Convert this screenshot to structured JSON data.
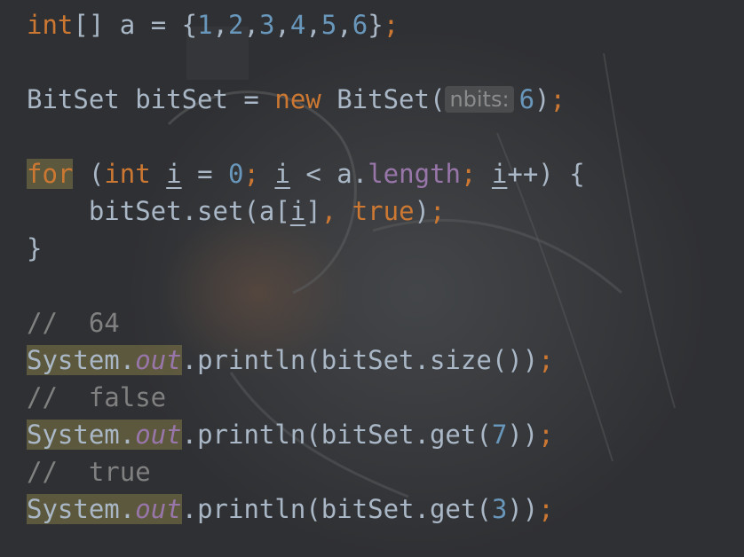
{
  "code": {
    "line1": {
      "type": "int",
      "decl": "[] a = {",
      "nums": [
        "1",
        "2",
        "3",
        "4",
        "5",
        "6"
      ],
      "comma": ",",
      "close": "}",
      "semi": ";"
    },
    "line2": {
      "decl": "BitSet bitSet = ",
      "kw_new": "new",
      "ctor": " BitSet(",
      "hint": "nbits:",
      "arg": "6",
      "close": ")",
      "semi": ";"
    },
    "line3": {
      "kw_for": "for",
      "sp": " (",
      "kw_int": "int",
      "sp2": " ",
      "var": "i",
      "eq": " = ",
      "zero": "0",
      "semi": ";",
      "sp3": " ",
      "lt": " < a.",
      "length": "length",
      "semi2": ";",
      "sp4": " ",
      "inc": "++) {"
    },
    "line4": {
      "indent": "    ",
      "call": "bitSet.set(a[",
      "var": "i",
      "close": "]",
      "comma": ", ",
      "kw_true": "true",
      "paren": ")",
      "semi": ";"
    },
    "line5": {
      "brace": "}"
    },
    "line6": {
      "comment": "//  64"
    },
    "line7": {
      "system": "System",
      "dot": ".",
      "out": "out",
      "call": ".println(bitSet.size())",
      "semi": ";"
    },
    "line8": {
      "comment": "//  false"
    },
    "line9": {
      "system": "System",
      "dot": ".",
      "out": "out",
      "call": ".println(bitSet.get(",
      "arg": "7",
      "close": "))",
      "semi": ";"
    },
    "line10": {
      "comment": "//  true"
    },
    "line11": {
      "system": "System",
      "dot": ".",
      "out": "out",
      "call": ".println(bitSet.get(",
      "arg": "3",
      "close": "))",
      "semi": ";"
    }
  },
  "colors": {
    "background": "#2f3033",
    "keyword": "#cc7832",
    "number": "#6897bb",
    "text": "#a9b7c6",
    "comment": "#808080",
    "field": "#9876aa",
    "highlight": "#8e844a"
  }
}
